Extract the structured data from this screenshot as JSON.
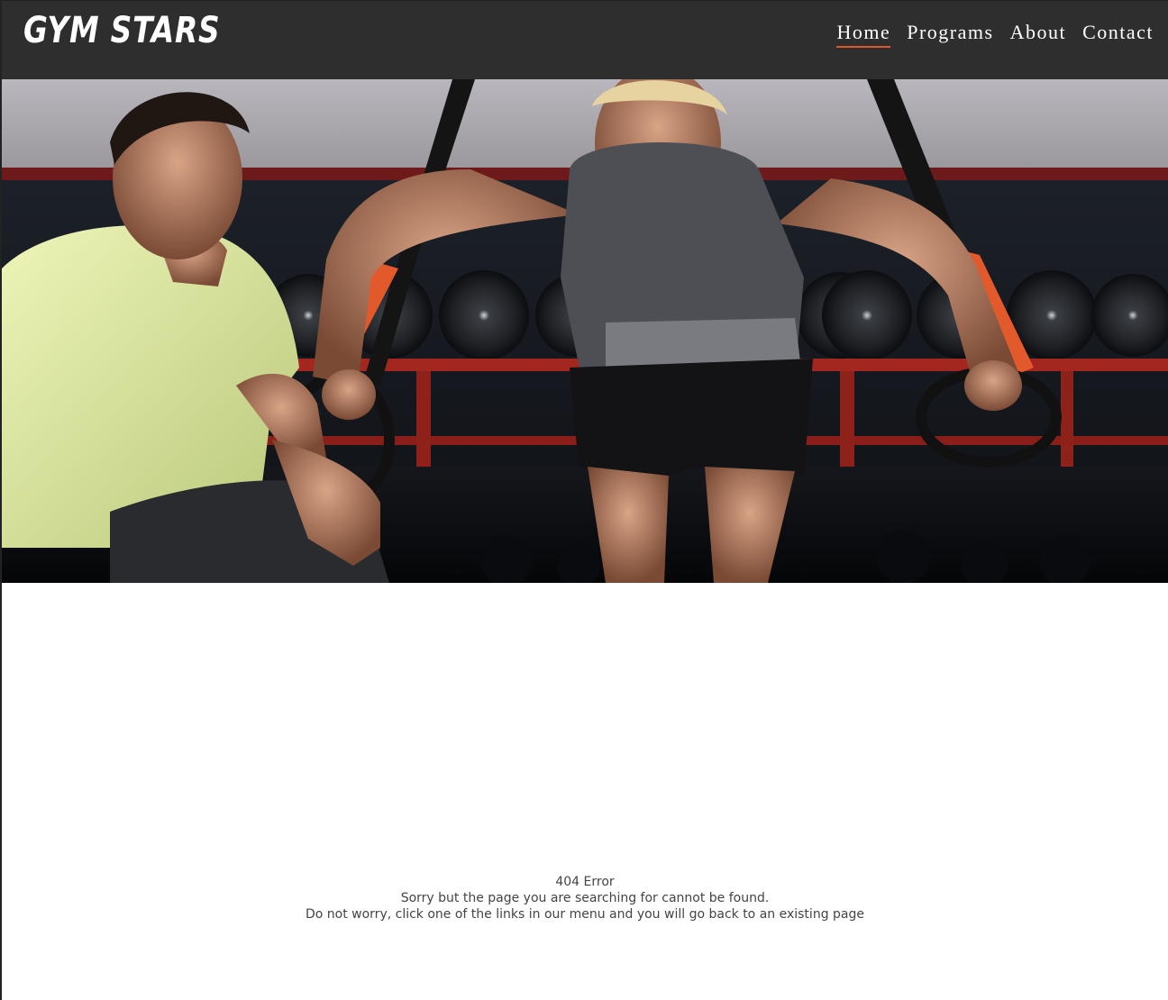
{
  "site": {
    "logo": "GYM STARS"
  },
  "nav": {
    "items": [
      {
        "label": "Home",
        "active": true
      },
      {
        "label": "Programs",
        "active": false
      },
      {
        "label": "About",
        "active": false
      },
      {
        "label": "Contact",
        "active": false
      }
    ]
  },
  "hero": {
    "icon": "hero-photo"
  },
  "error": {
    "title": "404 Error",
    "line1": "Sorry but the page you are searching for cannot be found.",
    "line2": "Do not worry, click one of the links in our menu and you will go back to an existing page"
  },
  "colors": {
    "header_bg": "#2e2e2e",
    "accent": "#e4572e",
    "text": "#444444"
  }
}
